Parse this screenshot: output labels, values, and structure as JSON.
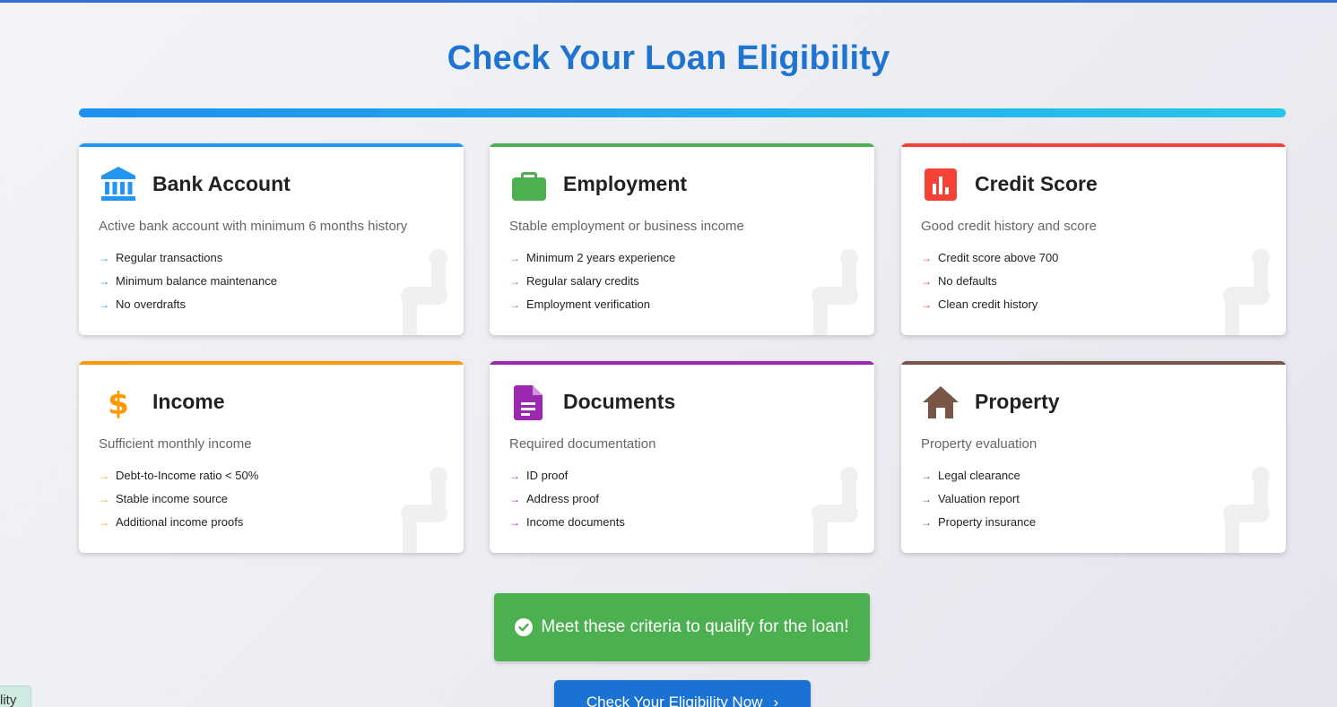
{
  "page": {
    "title": "Check Your Loan Eligibility"
  },
  "colors": {
    "title": "#1e74d0",
    "bank": "#2196f3",
    "employment": "#4caf50",
    "credit": "#f44336",
    "income": "#ff9800",
    "documents": "#9c27b0",
    "property": "#795548",
    "notice": "#4caf50",
    "cta": "#1a73d3"
  },
  "cards": [
    {
      "title": "Bank Account",
      "icon": "bank-icon",
      "description": "Active bank account with minimum 6 months history",
      "items": [
        "Regular transactions",
        "Minimum balance maintenance",
        "No overdrafts"
      ]
    },
    {
      "title": "Employment",
      "icon": "briefcase-icon",
      "description": "Stable employment or business income",
      "items": [
        "Minimum 2 years experience",
        "Regular salary credits",
        "Employment verification"
      ]
    },
    {
      "title": "Credit Score",
      "icon": "bar-chart-icon",
      "description": "Good credit history and score",
      "items": [
        "Credit score above 700",
        "No defaults",
        "Clean credit history"
      ]
    },
    {
      "title": "Income",
      "icon": "dollar-icon",
      "description": "Sufficient monthly income",
      "items": [
        "Debt-to-Income ratio < 50%",
        "Stable income source",
        "Additional income proofs"
      ]
    },
    {
      "title": "Documents",
      "icon": "document-icon",
      "description": "Required documentation",
      "items": [
        "ID proof",
        "Address proof",
        "Income documents"
      ]
    },
    {
      "title": "Property",
      "icon": "home-icon",
      "description": "Property evaluation",
      "items": [
        "Legal clearance",
        "Valuation report",
        "Property insurance"
      ]
    }
  ],
  "bullet_glyph": "→",
  "notice": {
    "text": "Meet these criteria to qualify for the loan!"
  },
  "cta": {
    "label": "Check Your Eligibility Now",
    "chevron": "›"
  },
  "side_tab": {
    "text": "lity"
  }
}
